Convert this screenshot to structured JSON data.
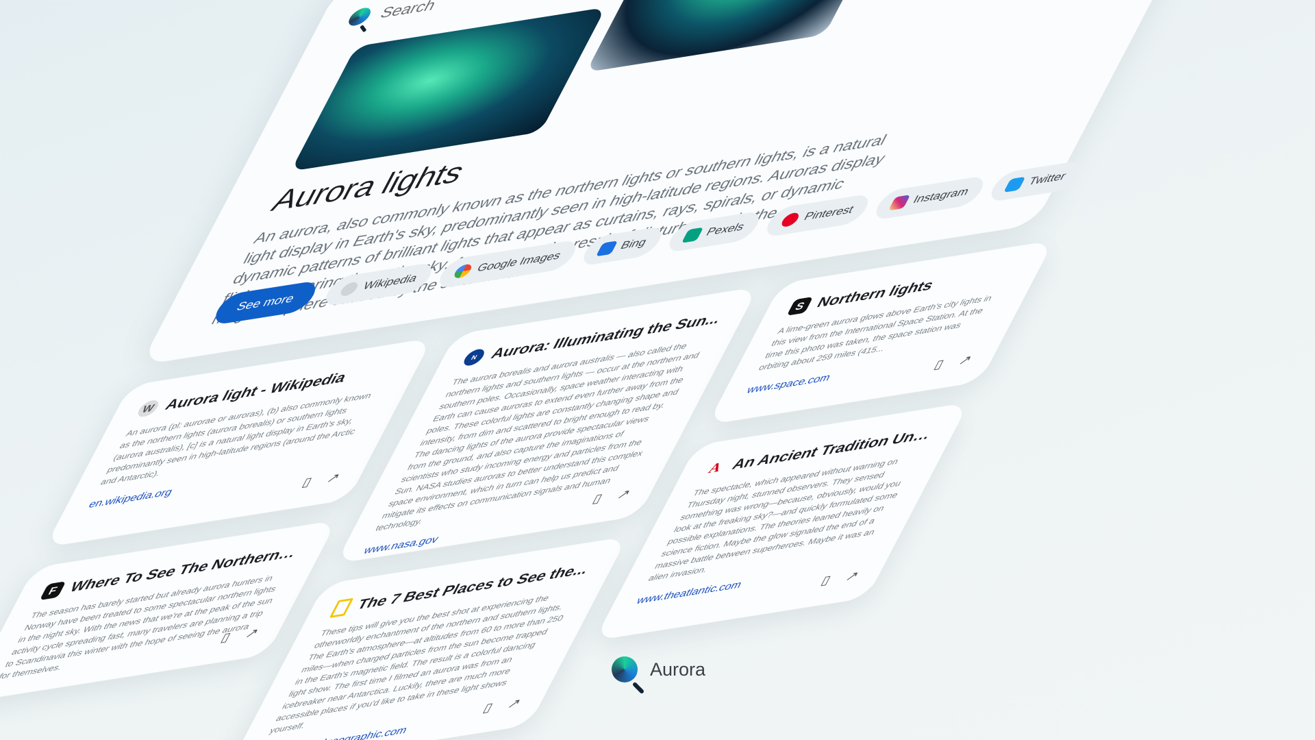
{
  "search": {
    "placeholder": "Search"
  },
  "main": {
    "title": "Aurora lights",
    "description": "An aurora, also commonly known as the northern lights or southern lights, is a natural light display in Earth's sky, predominantly seen in high-latitude regions. Auroras display dynamic patterns of brilliant lights that appear as curtains, rays, spirals, or dynamic flickers covering the entire sky. Auroras are the result of disturbances in the magnetosphere caused by the solar wind.",
    "see_more": "See more",
    "sources": [
      {
        "label": "Wikipedia",
        "icon": "wikipedia-icon",
        "color": "#cfd4d8"
      },
      {
        "label": "Google Images",
        "icon": "google-icon",
        "color": "#4285F4"
      },
      {
        "label": "Bing",
        "icon": "bing-icon",
        "color": "#1b6fe0"
      },
      {
        "label": "Pexels",
        "icon": "pexels-icon",
        "color": "#05a081"
      },
      {
        "label": "Pinterest",
        "icon": "pinterest-icon",
        "color": "#e60023"
      },
      {
        "label": "Instagram",
        "icon": "instagram-icon",
        "color": "#d62976"
      },
      {
        "label": "Twitter",
        "icon": "twitter-icon",
        "color": "#1d9bf0"
      }
    ]
  },
  "results": [
    {
      "title": "Aurora light - Wikipedia",
      "body": "An aurora (pl: aurorae or auroras), (b) also commonly known as the northern lights (aurora borealis) or southern lights (aurora australis), [c] is a natural light display in Earth's sky, predominantly seen in high-latitude regions (around the Arctic and Antarctic).",
      "url": "en.wikipedia.org",
      "icon": "wikipedia-icon",
      "fav": "W"
    },
    {
      "title": "Where To See The Northern L...",
      "body": "The season has barely started but already aurora hunters in Norway have been treated to some spectacular northern lights in the night sky. With the news that we're at the peak of the sun activity cycle spreading fast, many travelers are planning a trip to Scandinavia this winter with the hope of seeing the aurora for themselves.",
      "url": "",
      "icon": "forbes-icon",
      "fav": "F"
    },
    {
      "title": "Aurora: Illuminating the Sun...",
      "body": "The aurora borealis and aurora australis — also called the northern lights and southern lights — occur at the northern and southern poles. Occasionally, space weather interacting with Earth can cause auroras to extend even further away from the poles. These colorful lights are constantly changing shape and intensity, from dim and scattered to bright enough to read by. The dancing lights of the aurora provide spectacular views from the ground, and also capture the imaginations of scientists who study incoming energy and particles from the Sun. NASA studies auroras to better understand this complex space environment, which in turn can help us predict and mitigate its effects on communication signals and human technology.",
      "url": "www.nasa.gov",
      "icon": "nasa-icon",
      "fav": "N"
    },
    {
      "title": "The 7 Best Places to See the...",
      "body": "These tips will give you the best shot at experiencing the otherworldly enchantment of the northern and southern lights. The Earth's atmosphere—at altitudes from 60 to more than 250 miles—when charged particles from the sun become trapped in the Earth's magnetic field. The result is a colorful dancing light show. The first time I filmed an aurora was from an icebreaker near Antarctica. Luckily, there are much more accessible places if you'd like to take in these light shows yourself.",
      "url": "www.nationalgeographic.com",
      "icon": "natgeo-icon",
      "fav": ""
    },
    {
      "title": "Northern lights",
      "body": "A lime-green aurora glows above Earth's city lights in this view from the International Space Station. At the time this photo was taken, the space station was orbiting about 259 miles (415...",
      "url": "www.space.com",
      "icon": "space-icon",
      "fav": "S"
    },
    {
      "title": "An Ancient Tradition Unfold...",
      "body": "The spectacle, which appeared without warning on Thursday night, stunned observers. They sensed something was wrong—because, obviously, would you look at the freaking sky?—and quickly formulated some possible explanations. The theories leaned heavily on science fiction. Maybe the glow signaled the end of a massive battle between superheroes. Maybe it was an alien invasion.",
      "url": "www.theatlantic.com",
      "icon": "atlantic-icon",
      "fav": "A"
    }
  ],
  "brand": {
    "name": "Aurora"
  }
}
